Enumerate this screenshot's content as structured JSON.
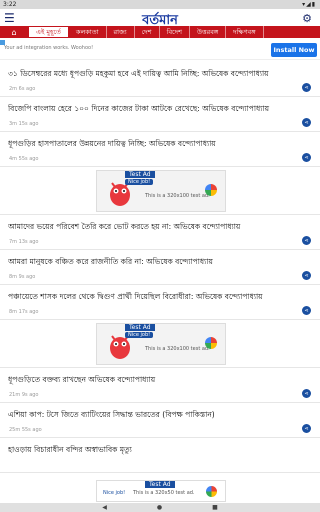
{
  "status": {
    "time": "3:22",
    "icons": "▾◢▮"
  },
  "header": {
    "menu_icon": "☰",
    "logo": "বর্তমান",
    "settings_icon": "⚙"
  },
  "nav": {
    "home_icon": "⌂",
    "tabs": [
      "এই মুহূর্তে",
      "কলকাতা",
      "রাজ্য",
      "দেশ",
      "বিদেশ",
      "উত্তরবঙ্গ",
      "দক্ষিণবঙ্গ"
    ],
    "active": 0
  },
  "top_ad": {
    "text": "Your ad integration works. Woohoo!",
    "install_label": "Install Now"
  },
  "items": [
    {
      "title": "৩১ ডিসেম্বরের মধ্যে ধূপগুড়ি মহকুমা হবে এই দায়িত্ব আমি নিচ্ছি: অভিষেক বন্দ্যোপাধ্যায়",
      "time": "2m 6s ago"
    },
    {
      "title": "বিজেপি বাংলায় হেরে ১০০ দিনের কাজের টাকা আটকে রেখেছে: অভিষেক বন্দ্যোপাধ্যায়",
      "time": "3m 15s ago"
    },
    {
      "title": "ধূপগুড়ির হাসপাতালের উন্নয়নের দায়িত্ব নিচ্ছি: অভিষেক বন্দ্যোপাধ্যায়",
      "time": "4m 55s ago"
    },
    {
      "title": "আমাদের ভয়ের পরিবেশ তৈরি করে ভোট করতে হয় না: অভিষেক বন্দ্যোপাধ্যায়",
      "time": "7m 13s ago"
    },
    {
      "title": "আমরা মানুষকে বঞ্চিত করে রাজনীতি করি না: অভিষেক বন্দ্যোপাধ্যায়",
      "time": "8m 9s ago"
    },
    {
      "title": "পঞ্চায়েতে শাসক দলের থেকে দ্বিগুণ প্রার্থী দিয়েছিল বিরোধীরা: অভিষেক বন্দ্যোপাধ্যায়",
      "time": "8m 17s ago"
    },
    {
      "title": "ধূপগুড়িতে বক্তব্য রাখছেন অভিষেক বন্দ্যোপাধ্যায়",
      "time": "21m 9s ago"
    },
    {
      "title": "এশিয়া কাপ: টসে জিতে ব্যাটিংয়ের সিদ্ধান্ত ভারতের (বিপক্ষ পাকিস্তান)",
      "time": "25m 55s ago"
    },
    {
      "title": "হাওড়ায় বিচারাধীন বন্দির অস্বাভাবিক মৃত্যু",
      "time": ""
    }
  ],
  "inline_ad": {
    "badge": "Test Ad",
    "nice": "Nice job!",
    "label": "This is a 320x100 test ad."
  },
  "bottom_ad": {
    "badge": "Test Ad",
    "nice": "Nice job!",
    "label": "This is a 320x50 test ad."
  },
  "navbar": {
    "back": "◀",
    "home": "●",
    "recents": "■"
  }
}
